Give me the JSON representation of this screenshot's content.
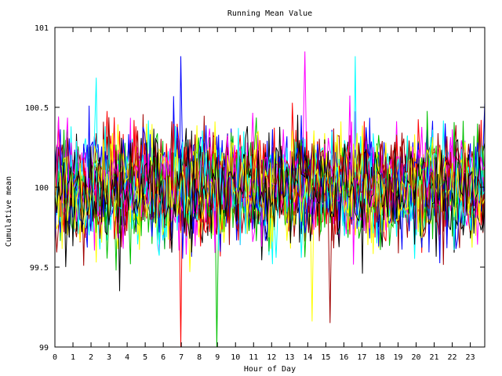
{
  "chart_data": {
    "type": "line",
    "title": "Running Mean Value",
    "xlabel": "Hour of Day",
    "ylabel": "Cumulative mean",
    "xlim": [
      0,
      23.8
    ],
    "ylim": [
      99,
      101
    ],
    "x_ticks": [
      "0",
      "1",
      "2",
      "3",
      "4",
      "5",
      "6",
      "7",
      "8",
      "9",
      "10",
      "11",
      "12",
      "13",
      "14",
      "15",
      "16",
      "17",
      "18",
      "19",
      "20",
      "21",
      "22",
      "23"
    ],
    "y_ticks": [
      "99",
      "99.5",
      "100",
      "100.5",
      "101"
    ],
    "grid": false,
    "legend": "none",
    "series_count": 24,
    "points_per_series": 240,
    "colors": [
      "#ff0000",
      "#00c000",
      "#0000ff",
      "#ff00ff",
      "#00ffff",
      "#a00000",
      "#ffff00",
      "#000000"
    ],
    "baseline": 100.0,
    "spread_sd": 0.16,
    "notable_points": [
      {
        "hour": 7.0,
        "value": 99.0
      },
      {
        "hour": 9.0,
        "value": 99.0
      },
      {
        "hour": 6.95,
        "value": 100.82
      },
      {
        "hour": 13.8,
        "value": 100.85
      },
      {
        "hour": 16.6,
        "value": 100.82
      },
      {
        "hour": 15.2,
        "value": 99.15
      },
      {
        "hour": 14.2,
        "value": 99.16
      },
      {
        "hour": 3.55,
        "value": 99.35
      }
    ]
  }
}
